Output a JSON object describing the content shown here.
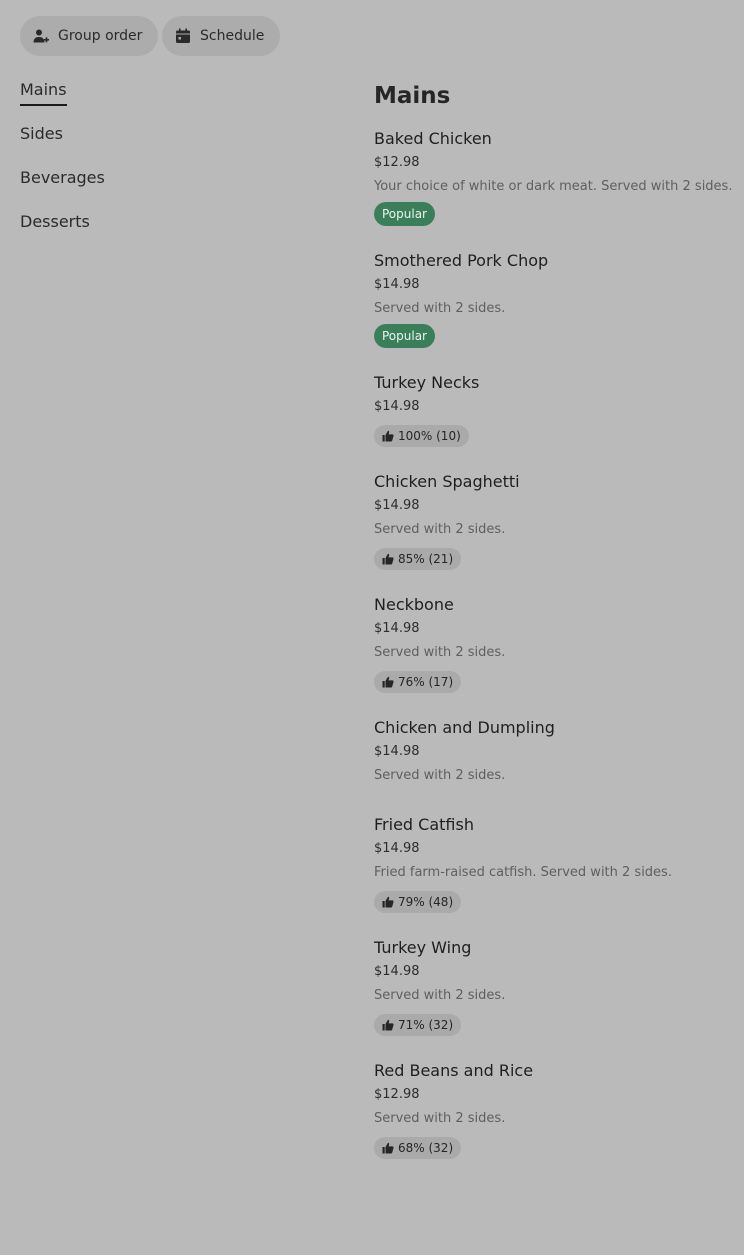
{
  "header": {
    "group_order_label": "Group order",
    "schedule_label": "Schedule",
    "group_order_icon": "person-add-icon",
    "schedule_icon": "calendar-icon"
  },
  "sidebar": {
    "items": [
      {
        "label": "Mains",
        "active": true
      },
      {
        "label": "Sides",
        "active": false
      },
      {
        "label": "Beverages",
        "active": false
      },
      {
        "label": "Desserts",
        "active": false
      }
    ]
  },
  "main": {
    "section_title": "Mains",
    "items": [
      {
        "name": "Baked Chicken",
        "price": "$12.98",
        "description": "Your choice of white or dark meat. Served with 2 sides.",
        "badge": "Popular",
        "rating": null
      },
      {
        "name": "Smothered Pork Chop",
        "price": "$14.98",
        "description": "Served with 2 sides.",
        "badge": "Popular",
        "rating": null
      },
      {
        "name": "Turkey Necks",
        "price": "$14.98",
        "description": null,
        "badge": null,
        "rating": "100% (10)"
      },
      {
        "name": "Chicken Spaghetti",
        "price": "$14.98",
        "description": "Served with 2 sides.",
        "badge": null,
        "rating": "85% (21)"
      },
      {
        "name": "Neckbone",
        "price": "$14.98",
        "description": "Served with 2 sides.",
        "badge": null,
        "rating": "76% (17)"
      },
      {
        "name": "Chicken and Dumpling",
        "price": "$14.98",
        "description": "Served with 2 sides.",
        "badge": null,
        "rating": null
      },
      {
        "name": "Fried Catfish",
        "price": "$14.98",
        "description": "Fried farm-raised catfish. Served with 2 sides.",
        "badge": null,
        "rating": "79% (48)"
      },
      {
        "name": "Turkey Wing",
        "price": "$14.98",
        "description": "Served with 2 sides.",
        "badge": null,
        "rating": "71% (32)"
      },
      {
        "name": "Red Beans and Rice",
        "price": "$12.98",
        "description": "Served with 2 sides.",
        "badge": null,
        "rating": "68% (32)"
      }
    ]
  },
  "colors": {
    "background": "#bababa",
    "popular_badge": "#3b7f5a",
    "rating_pill": "#aaaaaa"
  }
}
